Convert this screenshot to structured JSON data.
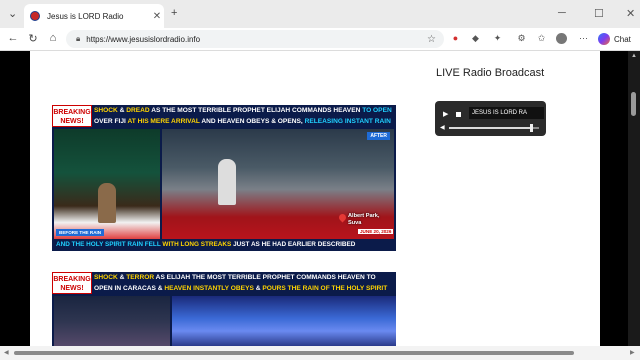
{
  "browser": {
    "tab_title": "Jesus is LORD Radio",
    "new_tab_symbol": "+",
    "url": "https://www.jesusislordradio.info",
    "copilot_label": "Chat"
  },
  "sidebar": {
    "live_heading": "LIVE Radio Broadcast",
    "player": {
      "station_text": "JESUS IS LORD RA",
      "volume_level": 0.92
    }
  },
  "posts": [
    {
      "badge_line1": "BREAKING",
      "badge_line2": "NEWS!",
      "headline": {
        "part1": "SHOCK",
        "part2": " & ",
        "part3": "DREAD",
        "part4": " AS THE MOST TERRIBLE PROPHET ELIJAH COMMANDS HEAVEN ",
        "part5": "TO OPEN",
        "part6": " OVER FIJI ",
        "part7": "AT HIS MERE ARRIVAL",
        "part8": " AND HEAVEN OBEYS & OPENS, ",
        "part9": "RELEASING INSTANT RAIN"
      },
      "label_after": "AFTER",
      "label_before": "BEFORE THE RAIN",
      "place_line1": "Albert Park,",
      "place_line2": "Suva",
      "date": "JUNE 20, 2026",
      "caption": {
        "part1": "AND THE HOLY SPIRIT RAIN FELL",
        "part2": " WITH LONG STREAKS",
        "part3": " JUST AS HE HAD EARLIER DESCRIBED"
      }
    },
    {
      "badge_line1": "BREAKING",
      "badge_line2": "NEWS!",
      "headline": {
        "part1": "SHOCK",
        "part2": " & ",
        "part3": "TERROR",
        "part4": " AS ELIJAH THE MOST TERRIBLE PROPHET COMMANDS HEAVEN TO OPEN IN CARACAS & ",
        "part5": "HEAVEN INSTANTLY OBEYS",
        "part6": " & ",
        "part7": "POURS THE RAIN OF THE HOLY SPIRIT"
      }
    }
  ],
  "colors": {
    "banner_navy": "#0b1b4a",
    "accent_yellow": "#ffd400",
    "accent_cyan": "#20d0ff",
    "breaking_red": "#cc0000"
  }
}
